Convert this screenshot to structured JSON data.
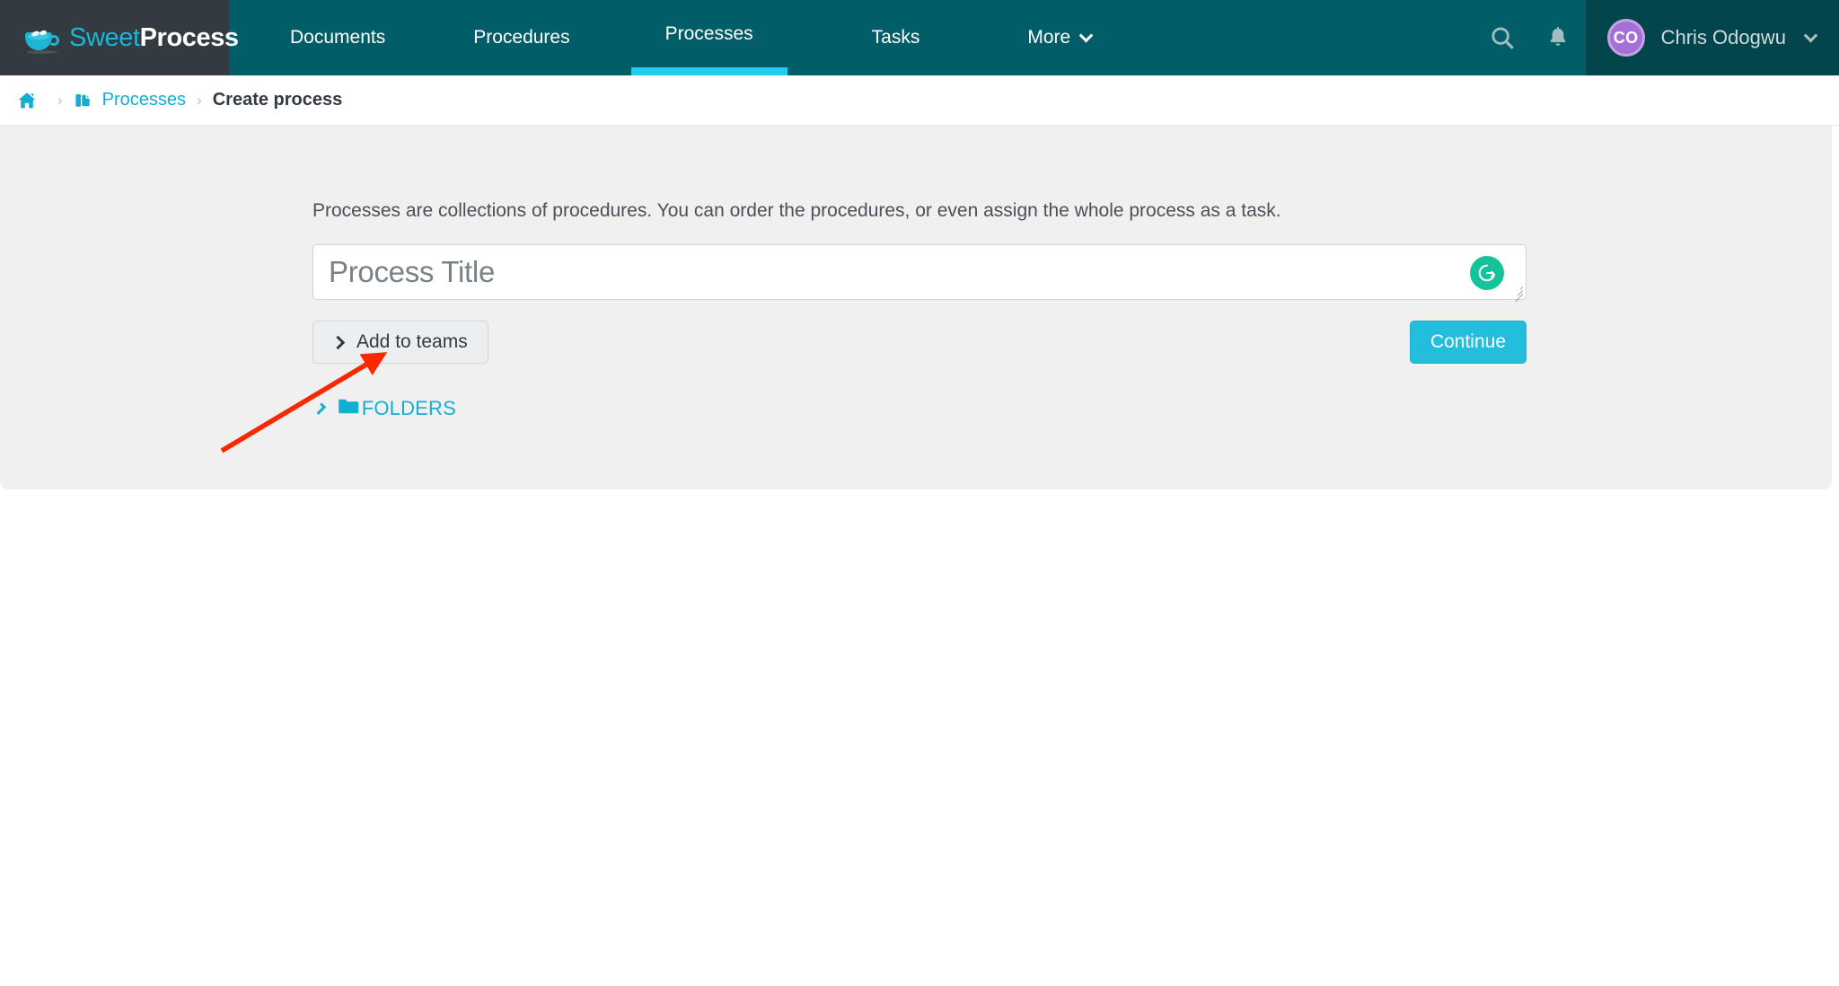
{
  "app": {
    "logo_text_light": "Sweet",
    "logo_text_bold": "Process"
  },
  "nav": {
    "items": [
      {
        "label": "Documents",
        "active": false
      },
      {
        "label": "Procedures",
        "active": false
      },
      {
        "label": "Processes",
        "active": true
      },
      {
        "label": "Tasks",
        "active": false
      },
      {
        "label": "More",
        "active": false,
        "has_caret": true
      }
    ],
    "search_icon": "search-icon",
    "notifications_icon": "bell-icon",
    "user": {
      "initials": "CO",
      "name": "Chris Odogwu",
      "caret": "chevron-down-icon"
    },
    "accent_active": "#22CCEE",
    "bar_color": "#015E68",
    "logo_panel_color": "#333A41",
    "user_panel_color": "#03454C"
  },
  "breadcrumb": {
    "home_icon": "home-icon",
    "separator": "›",
    "items": [
      {
        "label": "Processes",
        "icon": "documents-icon",
        "link": true
      },
      {
        "label": "Create process",
        "link": false
      }
    ],
    "link_color": "#12AFD3",
    "current_color": "#333A41"
  },
  "main": {
    "description": "Processes are collections of procedures. You can order the procedures, or even assign the whole process as a task.",
    "title_input": {
      "value": "",
      "placeholder": "Process Title",
      "grammarly_icon": "grammarly-icon",
      "grammarly_color": "#15C39A",
      "resize_handle": "resize-grip-icon"
    },
    "add_to_teams_button": {
      "label": "Add to teams",
      "icon": "chevron-right-icon"
    },
    "continue_button": {
      "label": "Continue",
      "color": "#22BEDC"
    },
    "folders_toggle": {
      "label": "FOLDERS",
      "chevron_icon": "chevron-right-icon",
      "folder_icon": "folder-icon",
      "color": "#12AFD3"
    },
    "panel_color": "#f0f0f0"
  },
  "annotation": {
    "arrow_color": "#FA2800",
    "description": "red arrow pointing to process title input"
  }
}
